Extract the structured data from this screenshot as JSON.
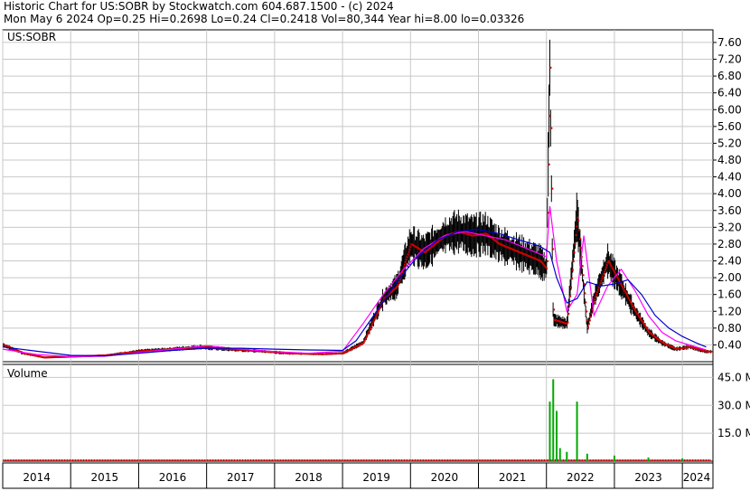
{
  "header": {
    "line1": "Historic Chart for US:SOBR by Stockwatch.com 604.687.1500 - (c) 2024",
    "line2": "Mon May  6 2024   Op=0.25   Hi=0.2698   Lo=0.24   Cl=0.2418   Vol=80,344   Year hi=8.00   lo=0.03326"
  },
  "chart_data": [
    {
      "type": "line",
      "title": "US:SOBR",
      "ylim": [
        0,
        7.9
      ],
      "y_ticks": [
        "0.40",
        "0.80",
        "1.20",
        "1.60",
        "2.00",
        "2.40",
        "2.80",
        "3.20",
        "3.60",
        "4.00",
        "4.40",
        "4.80",
        "5.20",
        "5.60",
        "6.00",
        "6.40",
        "6.80",
        "7.20",
        "7.60"
      ],
      "x_ticks": [
        "2014",
        "2015",
        "2016",
        "2017",
        "2018",
        "2019",
        "2020",
        "2021",
        "2022",
        "2023",
        "2024"
      ],
      "grid": true,
      "colors": {
        "price": "#000000",
        "close_marks": "#cc0000",
        "ma_short": "#ff00ff",
        "ma_long": "#0000cc"
      },
      "series": [
        {
          "role": "price",
          "x": [
            2014.0,
            2014.3,
            2014.6,
            2015.0,
            2015.5,
            2016.0,
            2016.5,
            2016.9,
            2017.3,
            2017.8,
            2018.2,
            2018.7,
            2019.0,
            2019.3,
            2019.6,
            2019.8,
            2020.0,
            2020.2,
            2020.5,
            2020.7,
            2020.9,
            2021.1,
            2021.3,
            2021.6,
            2021.9,
            2022.0,
            2022.05,
            2022.1,
            2022.3,
            2022.45,
            2022.6,
            2022.7,
            2022.9,
            2023.1,
            2023.3,
            2023.5,
            2023.7,
            2023.9,
            2024.1,
            2024.35
          ],
          "y": [
            0.4,
            0.2,
            0.1,
            0.12,
            0.15,
            0.25,
            0.3,
            0.35,
            0.3,
            0.25,
            0.2,
            0.18,
            0.2,
            0.45,
            1.5,
            1.8,
            2.8,
            2.6,
            3.0,
            3.1,
            3.0,
            3.05,
            2.8,
            2.6,
            2.4,
            2.2,
            7.0,
            1.0,
            0.9,
            3.5,
            0.8,
            1.5,
            2.4,
            1.8,
            1.2,
            0.7,
            0.45,
            0.3,
            0.35,
            0.24
          ]
        },
        {
          "role": "ma_short",
          "x": [
            2014.0,
            2014.5,
            2015.0,
            2015.5,
            2016.0,
            2016.5,
            2017.0,
            2017.5,
            2018.0,
            2018.5,
            2019.0,
            2019.3,
            2019.6,
            2019.9,
            2020.2,
            2020.5,
            2020.8,
            2021.1,
            2021.4,
            2021.7,
            2022.0,
            2022.05,
            2022.15,
            2022.3,
            2022.45,
            2022.55,
            2022.7,
            2022.9,
            2023.1,
            2023.3,
            2023.5,
            2023.7,
            2023.9,
            2024.1,
            2024.35
          ],
          "y": [
            0.3,
            0.17,
            0.12,
            0.13,
            0.22,
            0.3,
            0.38,
            0.3,
            0.24,
            0.2,
            0.25,
            0.9,
            1.6,
            2.2,
            2.7,
            3.0,
            3.1,
            3.0,
            2.9,
            2.7,
            2.5,
            3.7,
            2.4,
            1.2,
            1.6,
            3.0,
            1.1,
            1.8,
            2.2,
            1.7,
            1.1,
            0.7,
            0.5,
            0.4,
            0.28
          ]
        },
        {
          "role": "ma_long",
          "x": [
            2014.0,
            2014.5,
            2015.0,
            2015.5,
            2016.0,
            2016.5,
            2017.0,
            2017.5,
            2018.0,
            2018.5,
            2019.0,
            2019.2,
            2019.5,
            2019.8,
            2020.1,
            2020.4,
            2020.7,
            2021.0,
            2021.3,
            2021.6,
            2021.9,
            2022.05,
            2022.15,
            2022.3,
            2022.45,
            2022.6,
            2022.8,
            2023.0,
            2023.2,
            2023.4,
            2023.6,
            2023.8,
            2024.0,
            2024.2,
            2024.35
          ],
          "y": [
            0.35,
            0.25,
            0.15,
            0.14,
            0.2,
            0.27,
            0.32,
            0.32,
            0.3,
            0.28,
            0.27,
            0.5,
            1.2,
            1.9,
            2.5,
            2.9,
            3.1,
            3.15,
            3.05,
            2.9,
            2.75,
            2.6,
            2.0,
            1.4,
            1.5,
            1.9,
            1.8,
            1.85,
            1.95,
            1.6,
            1.1,
            0.8,
            0.6,
            0.45,
            0.35
          ]
        }
      ]
    },
    {
      "type": "bar",
      "title": "Volume",
      "ylim": [
        0,
        52
      ],
      "y_ticks": [
        "15.0 M",
        "30.0 M",
        "45.0 M"
      ],
      "x": [
        2022.05,
        2022.1,
        2022.15,
        2022.2,
        2022.3,
        2022.45,
        2022.6,
        2023.0,
        2023.5,
        2024.0
      ],
      "values": [
        32.0,
        44.0,
        27.0,
        7.0,
        5.0,
        32.0,
        4.0,
        3.0,
        2.0,
        1.5
      ],
      "colors": {
        "bars": "#00aa00",
        "baseline_bars": "#cc0000"
      }
    }
  ]
}
